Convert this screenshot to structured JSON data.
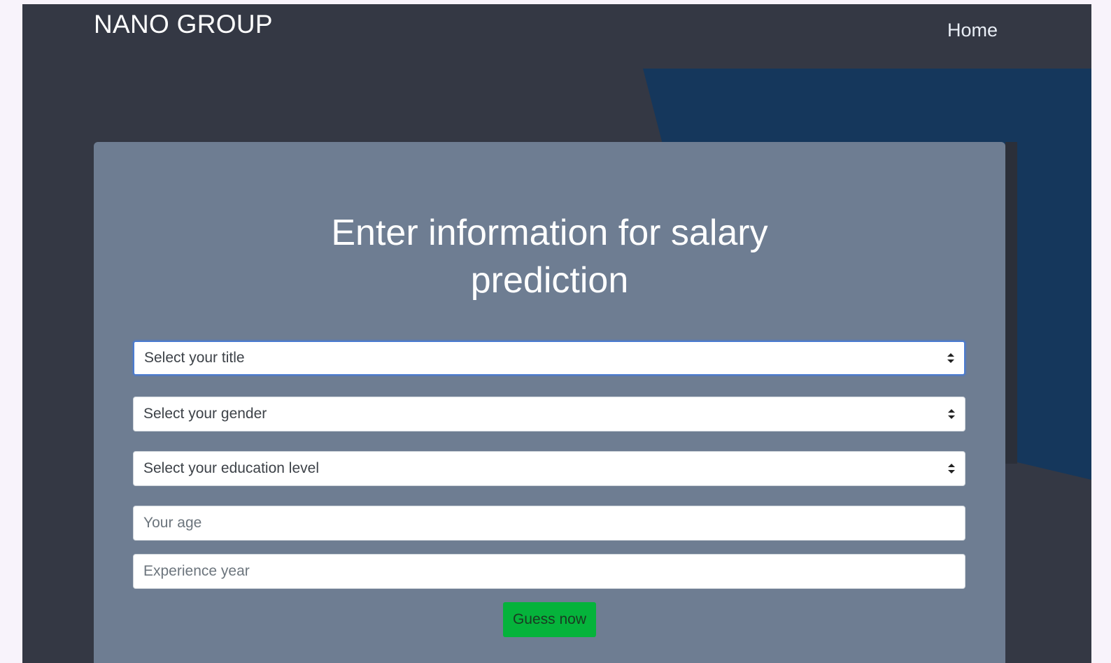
{
  "navbar": {
    "brand": "NANO GROUP",
    "home_label": "Home"
  },
  "form": {
    "title_line1": "Enter information for salary",
    "title_line2": "prediction",
    "title_select": {
      "selected": "Select your title"
    },
    "gender_select": {
      "selected": "Select your gender"
    },
    "education_select": {
      "selected": "Select your education level"
    },
    "age_input": {
      "placeholder": "Your age",
      "value": ""
    },
    "experience_input": {
      "placeholder": "Experience year",
      "value": ""
    },
    "submit_label": "Guess now"
  },
  "colors": {
    "page_bg": "#343844",
    "accent_shape": "#15375c",
    "card_bg": "#6e7d92",
    "button_bg": "#05b33b",
    "focus_border": "#4a7bd0"
  },
  "icons": {
    "select_arrows": "chevron-up-down-icon"
  }
}
